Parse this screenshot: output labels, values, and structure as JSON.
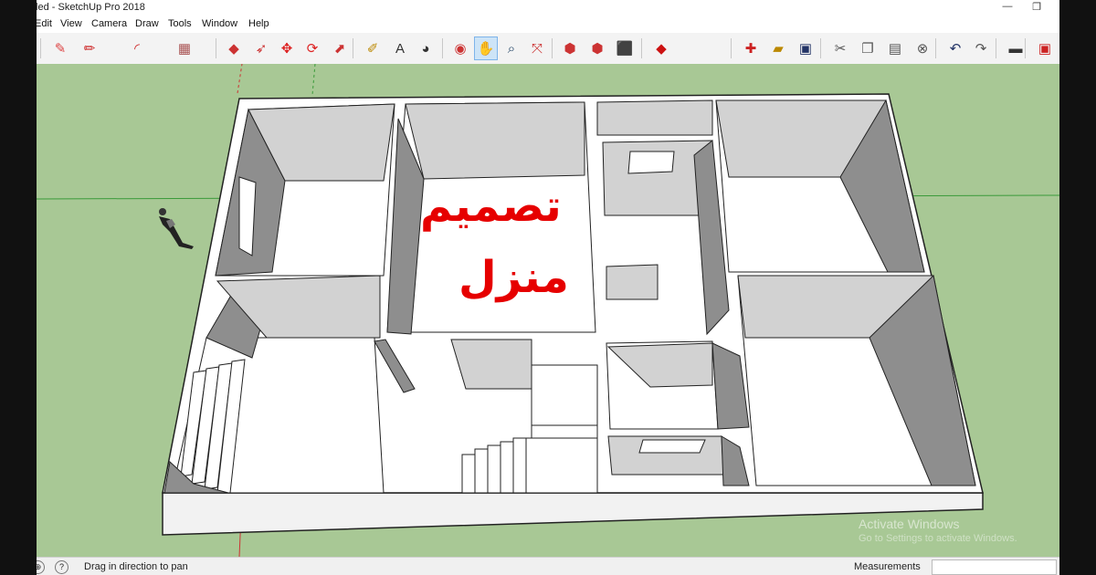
{
  "window": {
    "title": "tled - SketchUp Pro 2018",
    "minimize": "—",
    "restore": "❐"
  },
  "menu": [
    "Edit",
    "View",
    "Camera",
    "Draw",
    "Tools",
    "Window",
    "Help"
  ],
  "toolbar": {
    "icons": [
      {
        "name": "eraser-icon",
        "glyph": "✎",
        "color": "#d44"
      },
      {
        "name": "pencil-icon",
        "glyph": "✏",
        "color": "#c22"
      },
      {
        "name": "arc-icon",
        "glyph": "◜",
        "color": "#c22"
      },
      {
        "name": "rectangle-icon",
        "glyph": "▦",
        "color": "#a55"
      },
      {
        "name": "push-pull-icon",
        "glyph": "◆",
        "color": "#c33"
      },
      {
        "name": "follow-me-icon",
        "glyph": "➶",
        "color": "#c33"
      },
      {
        "name": "move-icon",
        "glyph": "✥",
        "color": "#d22"
      },
      {
        "name": "rotate-icon",
        "glyph": "⟳",
        "color": "#d22"
      },
      {
        "name": "scale-icon",
        "glyph": "⬈",
        "color": "#c33"
      },
      {
        "name": "tape-measure-icon",
        "glyph": "✐",
        "color": "#b80"
      },
      {
        "name": "text-icon",
        "glyph": "A",
        "color": "#333"
      },
      {
        "name": "paint-bucket-icon",
        "glyph": "◕",
        "color": "#333"
      },
      {
        "name": "orbit-icon",
        "glyph": "◉",
        "color": "#c33"
      },
      {
        "name": "pan-icon",
        "glyph": "✋",
        "color": "#a70"
      },
      {
        "name": "zoom-icon",
        "glyph": "⌕",
        "color": "#246"
      },
      {
        "name": "zoom-extents-icon",
        "glyph": "⤧",
        "color": "#c33"
      },
      {
        "name": "warehouse-icon",
        "glyph": "⬢",
        "color": "#c33"
      },
      {
        "name": "extension-warehouse-icon",
        "glyph": "⬢",
        "color": "#c33"
      },
      {
        "name": "share-model-icon",
        "glyph": "⬛",
        "color": "#c33"
      },
      {
        "name": "ruby-icon",
        "glyph": "◆",
        "color": "#c11"
      },
      {
        "name": "new-icon",
        "glyph": "✚",
        "color": "#c22"
      },
      {
        "name": "open-icon",
        "glyph": "▰",
        "color": "#b80"
      },
      {
        "name": "save-icon",
        "glyph": "▣",
        "color": "#236"
      },
      {
        "name": "cut-icon",
        "glyph": "✂",
        "color": "#555"
      },
      {
        "name": "copy-icon",
        "glyph": "❐",
        "color": "#555"
      },
      {
        "name": "paste-icon",
        "glyph": "▤",
        "color": "#555"
      },
      {
        "name": "delete-icon",
        "glyph": "⊗",
        "color": "#555"
      },
      {
        "name": "undo-icon",
        "glyph": "↶",
        "color": "#236"
      },
      {
        "name": "redo-icon",
        "glyph": "↷",
        "color": "#555"
      },
      {
        "name": "print-icon",
        "glyph": "▬",
        "color": "#333"
      },
      {
        "name": "model-info-icon",
        "glyph": "▣",
        "color": "#c22"
      }
    ]
  },
  "overlay": {
    "line1": "تصميم",
    "line2": "منزل"
  },
  "watermark": {
    "line1": "Activate Windows",
    "line2": "Go to Settings to activate Windows."
  },
  "status": {
    "hint": "Drag in direction to pan",
    "measurements_label": "Measurements",
    "measurements_value": ""
  },
  "colors": {
    "ground": "#a8c895",
    "wall_top": "#ffffff",
    "wall_shade": "#8e8e8e",
    "floor": "#ffffff",
    "accent_text": "#e60000"
  }
}
